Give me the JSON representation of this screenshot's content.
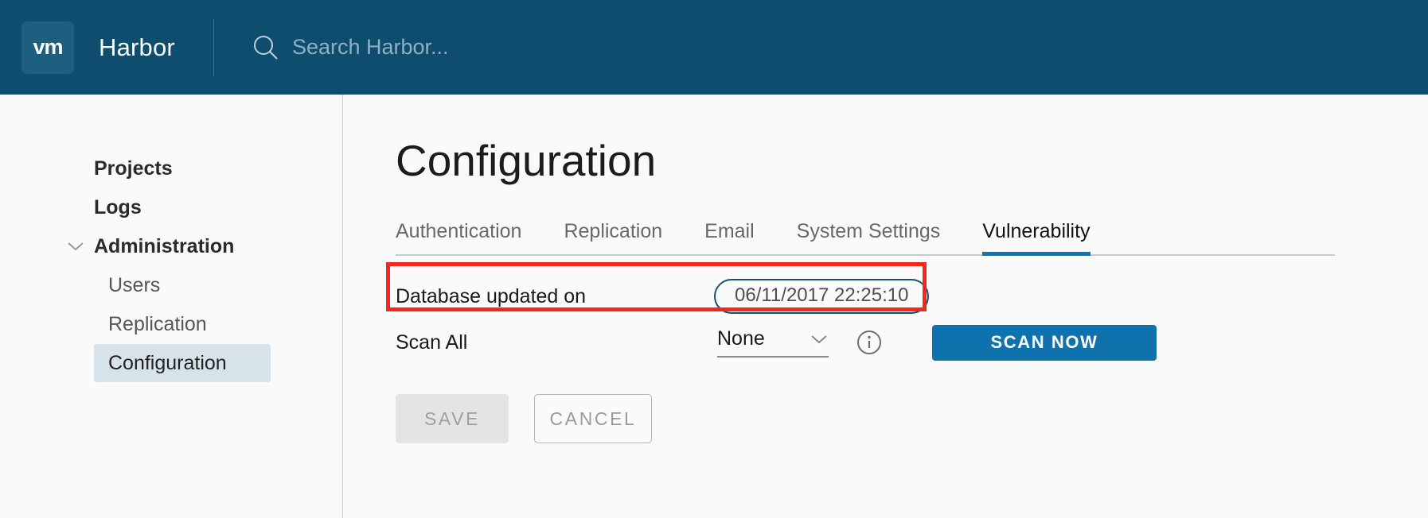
{
  "header": {
    "logo_text": "vm",
    "logo_icon": "vmware-logo-icon",
    "brand_title": "Harbor",
    "search_icon": "search-icon",
    "search_placeholder": "Search Harbor...",
    "search_value": "",
    "background_color": "#0f4d6e"
  },
  "sidebar": {
    "items": [
      {
        "label": "Projects",
        "level": "top",
        "active": false
      },
      {
        "label": "Logs",
        "level": "top",
        "active": false
      },
      {
        "label": "Administration",
        "level": "top",
        "active": false,
        "icon": "chevron-down-icon",
        "expanded": true
      },
      {
        "label": "Users",
        "level": "sub",
        "active": false
      },
      {
        "label": "Replication",
        "level": "sub",
        "active": false
      },
      {
        "label": "Configuration",
        "level": "sub",
        "active": true
      }
    ],
    "active_background": "#d7e3ea"
  },
  "main": {
    "page_title": "Configuration",
    "tabs": [
      {
        "label": "Authentication",
        "active": false
      },
      {
        "label": "Replication",
        "active": false
      },
      {
        "label": "Email",
        "active": false
      },
      {
        "label": "System Settings",
        "active": false
      },
      {
        "label": "Vulnerability",
        "active": true
      }
    ],
    "active_tab_color": "#0f76b4",
    "rows": {
      "database_updated": {
        "label": "Database updated on",
        "value": "06/11/2017 22:25:10",
        "highlight_color": "#f4271c"
      },
      "scan_all": {
        "label": "Scan All",
        "select_value": "None",
        "select_options": [
          "None"
        ],
        "caret_icon": "chevron-down-icon",
        "info_icon": "info-circle-icon",
        "scan_button_label": "SCAN NOW",
        "scan_button_color": "#1072ac"
      }
    },
    "actions": {
      "save_label": "SAVE",
      "save_disabled": true,
      "cancel_label": "CANCEL"
    }
  }
}
